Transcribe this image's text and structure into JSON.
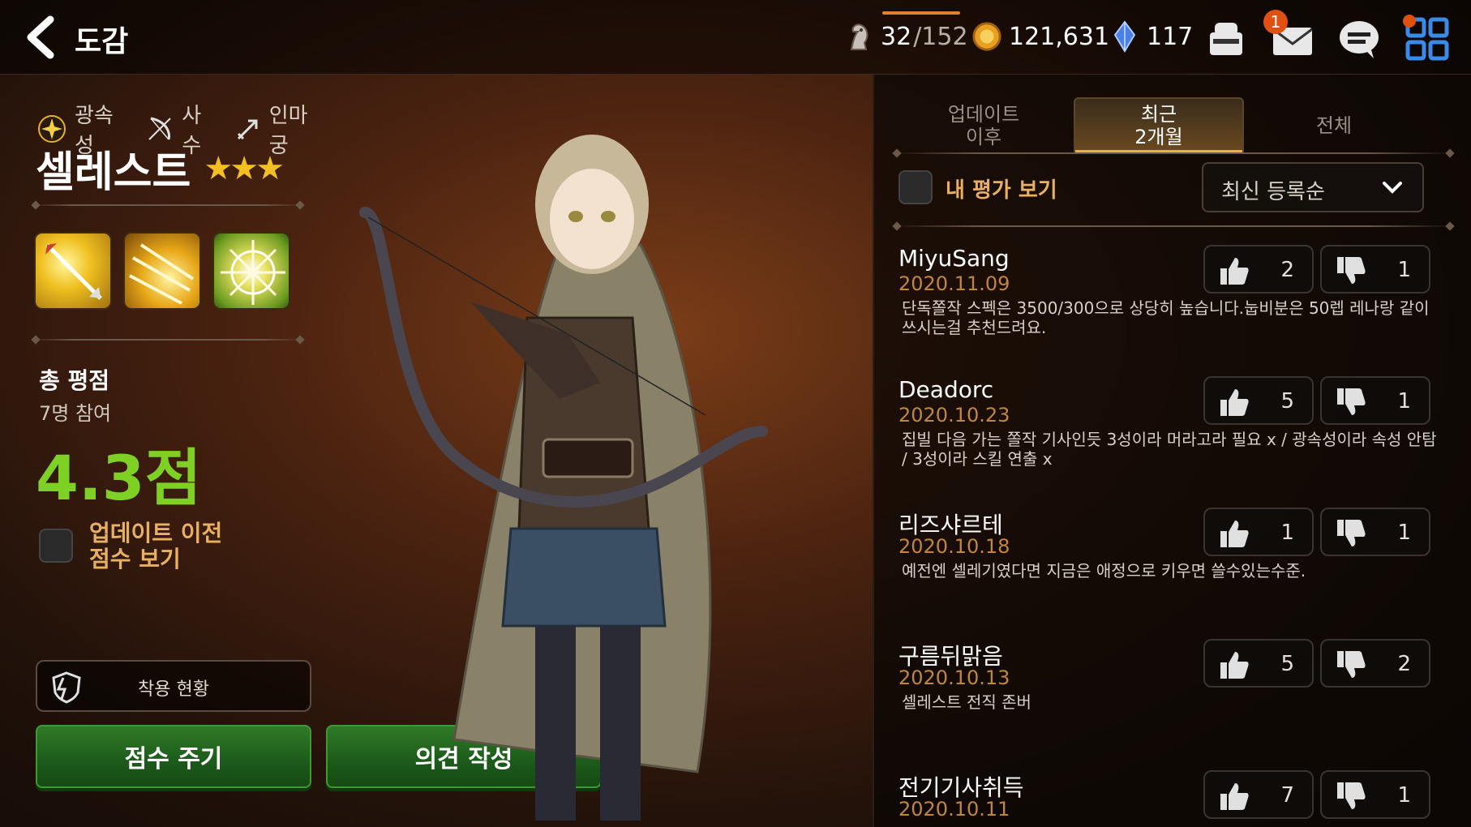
{
  "header": {
    "title": "도감",
    "stamina": "32",
    "stamina_max": "/152",
    "gold": "121,631",
    "crystal": "117",
    "mail_badge": "1"
  },
  "hero": {
    "element": "광속성",
    "class": "사수",
    "weapon": "인마궁",
    "name": "셀레스트",
    "stars": "★★★",
    "total_label": "총 평점",
    "participants": "7명 참여",
    "score": "4.3점",
    "prev_score_label_1": "업데이트 이전",
    "prev_score_label_2": "점수 보기",
    "equip_label": "착용 현황",
    "rate_button": "점수 주기",
    "opinion_button": "의견 작성"
  },
  "reviews_panel": {
    "tabs": [
      {
        "l1": "업데이트",
        "l2": "이후"
      },
      {
        "l1": "최근",
        "l2": "2개월"
      },
      {
        "l1": "전체",
        "l2": ""
      }
    ],
    "active_tab": 1,
    "my_review_label": "내 평가 보기",
    "sort_label": "최신 등록순",
    "reviews": [
      {
        "name": "MiyuSang",
        "date": "2020.11.09",
        "text": "단독쫄작 스펙은 3500/300으로 상당히 높습니다.눕비분은 50렙 레나랑 같이 쓰시는걸 추천드려요.",
        "up": "2",
        "down": "1"
      },
      {
        "name": "Deadorc",
        "date": "2020.10.23",
        "text": "집빌 다음 가는 쫄작 기사인듯 3성이라 머라고라 필요 x / 광속성이라 속성 안탐 / 3성이라 스킬 연출 x",
        "up": "5",
        "down": "1"
      },
      {
        "name": "리즈샤르테",
        "date": "2020.10.18",
        "text": "예전엔 셀레기였다면 지금은 애정으로 키우면 쓸수있는수준.",
        "up": "1",
        "down": "1"
      },
      {
        "name": "구름뒤맑음",
        "date": "2020.10.13",
        "text": "셀레스트 전직 존버",
        "up": "5",
        "down": "2"
      },
      {
        "name": "전기기사취득",
        "date": "2020.10.11",
        "text": "",
        "up": "7",
        "down": "1"
      }
    ]
  }
}
